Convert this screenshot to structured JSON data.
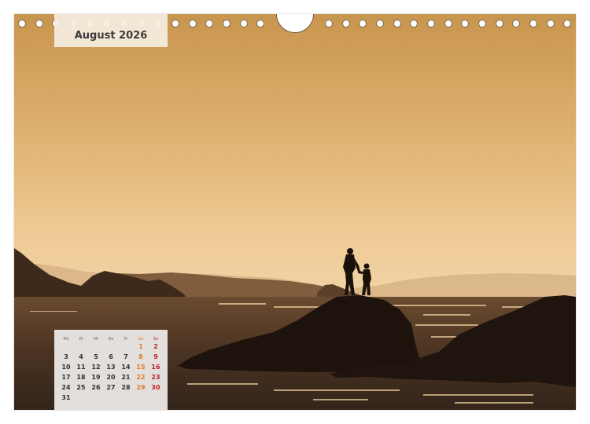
{
  "calendar": {
    "month_title": "August 2026",
    "weekdays": [
      "Mo",
      "Di",
      "Mi",
      "Do",
      "Fr",
      "Sa",
      "So"
    ],
    "weeks": [
      [
        "",
        "",
        "",
        "",
        "",
        "1",
        "2"
      ],
      [
        "3",
        "4",
        "5",
        "6",
        "7",
        "8",
        "9"
      ],
      [
        "10",
        "11",
        "12",
        "13",
        "14",
        "15",
        "16"
      ],
      [
        "17",
        "18",
        "19",
        "20",
        "21",
        "22",
        "23"
      ],
      [
        "24",
        "25",
        "26",
        "27",
        "28",
        "29",
        "30"
      ],
      [
        "31",
        "",
        "",
        "",
        "",
        "",
        ""
      ]
    ]
  },
  "photo": {
    "subject": "two children silhouetted on a rock by the sea at sunset",
    "sky_color": "#e8b97c",
    "sea_color": "#3a2a1f"
  },
  "colors": {
    "saturday": "#e07b22",
    "sunday": "#c2202a"
  }
}
